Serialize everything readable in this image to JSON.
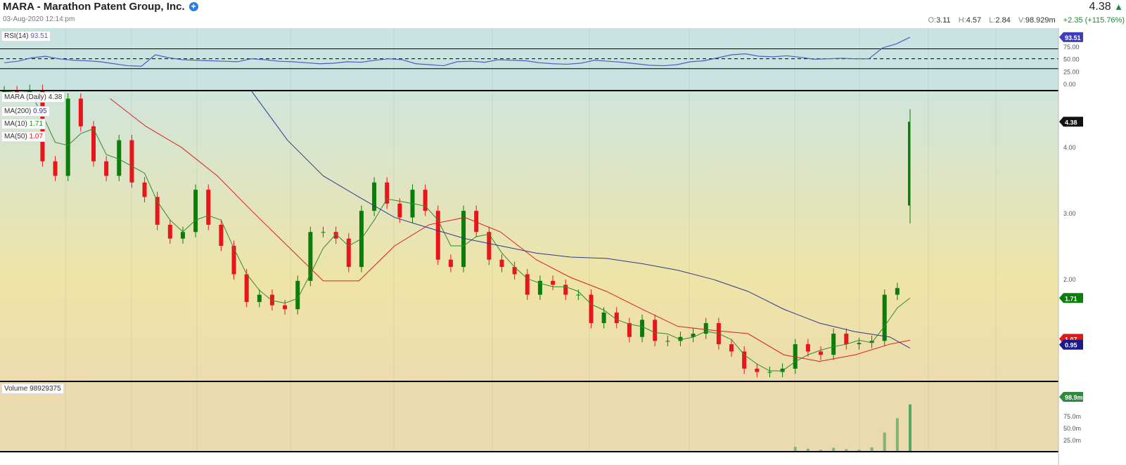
{
  "header": {
    "title": "MARA - Marathon Patent Group, Inc.",
    "date": "03-Aug-2020 12:14:pm",
    "price": "4.38",
    "up_icon": "triangle-up",
    "open": "3.11",
    "high": "4.57",
    "low": "2.84",
    "volume": "98.929m",
    "change": "+2.35 (+115.76%)",
    "labels": {
      "o": "O:",
      "h": "H:",
      "l": "L:",
      "v": "V:"
    }
  },
  "colors": {
    "up": "#0a7d0a",
    "down": "#e8151b",
    "ma200": "#2e3a8c",
    "ma50": "#d62020",
    "ma10": "#2e8b2e",
    "rsi": "#4a5fc8"
  },
  "chart_data": [
    {
      "type": "line",
      "name": "RSI(14)",
      "value_label": "93.51",
      "ylim": [
        0,
        100
      ],
      "ticks": [
        "75.00",
        "50.00",
        "25.00",
        "0.00"
      ],
      "levels": [
        70,
        50,
        30
      ],
      "values": [
        42,
        45,
        52,
        55,
        50,
        47,
        46,
        44,
        40,
        36,
        35,
        58,
        52,
        48,
        47,
        46,
        45,
        44,
        50,
        48,
        45,
        44,
        42,
        40,
        41,
        44,
        43,
        47,
        50,
        48,
        40,
        38,
        36,
        44,
        45,
        43,
        48,
        47,
        46,
        42,
        40,
        39,
        41,
        47,
        45,
        43,
        40,
        37,
        36,
        38,
        44,
        46,
        52,
        58,
        60,
        55,
        54,
        56,
        53,
        49,
        50,
        51,
        50,
        50,
        72,
        80,
        93.51
      ]
    },
    {
      "type": "candlestick",
      "title": "MARA (Daily)",
      "value_label": "4.38",
      "ylim": [
        0.47,
        4.87
      ],
      "ticks": [
        "4.00",
        "3.00",
        "2.00"
      ],
      "label_values": {
        "last": "4.38",
        "ma10": "1.71",
        "ma50": "1.07",
        "ma200": "0.95"
      },
      "closes": [
        4.84,
        4.8,
        4.86,
        3.78,
        3.56,
        4.73,
        4.31,
        3.78,
        3.56,
        4.1,
        3.46,
        3.24,
        2.82,
        2.61,
        2.71,
        3.35,
        2.82,
        2.5,
        2.07,
        1.65,
        1.76,
        1.6,
        1.54,
        1.97,
        2.71,
        2.71,
        2.61,
        2.18,
        3.03,
        3.46,
        3.14,
        2.93,
        3.35,
        3.03,
        2.29,
        2.18,
        3.03,
        2.71,
        2.29,
        2.18,
        2.07,
        1.76,
        1.97,
        1.91,
        1.76,
        1.76,
        1.33,
        1.49,
        1.33,
        1.12,
        1.38,
        1.06,
        1.06,
        1.12,
        1.17,
        1.33,
        1.01,
        0.9,
        0.64,
        0.59,
        0.59,
        0.64,
        1.01,
        0.9,
        0.85,
        1.17,
        1.01,
        1.03,
        1.06,
        1.76,
        1.86,
        4.38
      ],
      "last_candle": {
        "open": 3.11,
        "high": 4.57,
        "low": 2.84,
        "close": 4.38
      },
      "series": [
        {
          "name": "MA(200)",
          "value": "0.95",
          "points": [
            [
              19.4,
              4.84
            ],
            [
              22.2,
              4.1
            ],
            [
              25,
              3.56
            ],
            [
              27.8,
              3.24
            ],
            [
              30.6,
              2.93
            ],
            [
              33.3,
              2.77
            ],
            [
              36.1,
              2.61
            ],
            [
              38.9,
              2.5
            ],
            [
              41.7,
              2.39
            ],
            [
              44.4,
              2.33
            ],
            [
              47.2,
              2.31
            ],
            [
              50,
              2.23
            ],
            [
              52.8,
              2.13
            ],
            [
              55.6,
              1.99
            ],
            [
              58.3,
              1.81
            ],
            [
              61.1,
              1.54
            ],
            [
              63.9,
              1.33
            ],
            [
              66.7,
              1.2
            ],
            [
              69.4,
              1.12
            ],
            [
              71,
              0.95
            ]
          ]
        },
        {
          "name": "MA(50)",
          "value": "1.07",
          "points": [
            [
              8.3,
              4.73
            ],
            [
              11.1,
              4.31
            ],
            [
              13.9,
              3.99
            ],
            [
              16.7,
              3.56
            ],
            [
              19.4,
              3.03
            ],
            [
              22.2,
              2.5
            ],
            [
              25,
              1.97
            ],
            [
              27.8,
              1.97
            ],
            [
              30.6,
              2.5
            ],
            [
              33.3,
              2.82
            ],
            [
              36.1,
              2.93
            ],
            [
              38.9,
              2.71
            ],
            [
              41.7,
              2.29
            ],
            [
              44.4,
              2.02
            ],
            [
              47.2,
              1.81
            ],
            [
              50,
              1.54
            ],
            [
              52.8,
              1.28
            ],
            [
              55.6,
              1.22
            ],
            [
              58.3,
              1.17
            ],
            [
              61.1,
              0.85
            ],
            [
              63.9,
              0.75
            ],
            [
              66.7,
              0.85
            ],
            [
              69.4,
              1.01
            ],
            [
              71,
              1.07
            ]
          ]
        },
        {
          "name": "MA(10)",
          "value": "1.71"
        }
      ]
    },
    {
      "type": "bar",
      "title": "Volume",
      "value_label": "98929375",
      "axis_label": "98.9m",
      "ticks": [
        "75.0m",
        "50.0m",
        "25.0m"
      ],
      "ylim": [
        0,
        100
      ],
      "values": [
        1,
        1,
        1,
        1,
        1,
        1,
        1,
        1,
        1,
        1,
        1,
        1,
        1,
        1,
        1,
        1,
        1,
        1,
        1,
        1,
        1,
        1,
        1,
        1,
        1,
        1,
        1,
        1,
        1,
        1,
        1,
        1,
        1,
        1,
        1,
        1,
        1,
        1,
        1,
        1,
        1,
        1,
        1,
        1,
        1,
        1,
        1,
        1,
        1,
        1,
        1,
        1,
        1,
        1,
        1,
        1,
        1,
        1,
        1,
        1,
        1,
        1,
        10,
        6,
        4,
        8,
        5,
        4,
        9,
        40,
        70,
        98.9
      ]
    }
  ]
}
